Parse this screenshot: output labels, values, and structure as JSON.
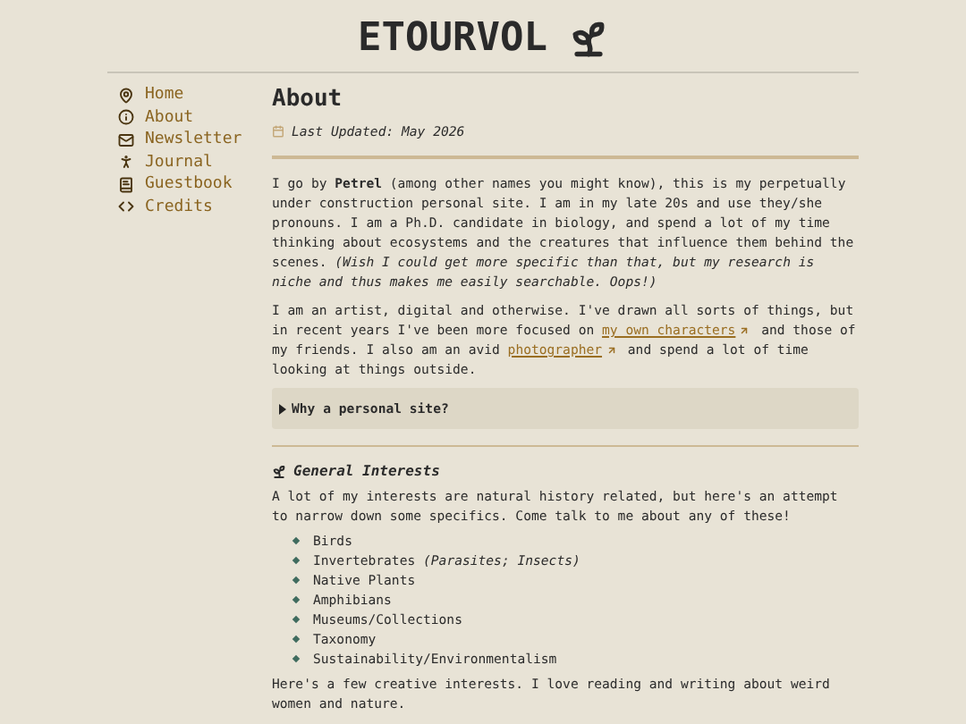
{
  "site_title": "ETOURVOL",
  "nav": [
    {
      "kind": "pin",
      "label": "Home"
    },
    {
      "kind": "info",
      "label": "About"
    },
    {
      "kind": "mail",
      "label": "Newsletter"
    },
    {
      "kind": "hiker",
      "label": "Journal"
    },
    {
      "kind": "book",
      "label": "Guestbook"
    },
    {
      "kind": "code",
      "label": "Credits"
    }
  ],
  "page": {
    "heading": "About",
    "last_updated": "Last Updated: May 2026",
    "paragraphs": [
      [
        {
          "kind": "text",
          "text": "I go by **Petrel** (among other names you might know), this is my perpetually under construction personal site. I am in my late 20s and use they/she pronouns. I am a Ph.D. candidate in biology, and spend a lot of my time thinking about ecosystems and the creatures that influence them behind the scenes. *(Wish I could get more specific than that, but my research is niche and thus makes me easily searchable. Oops!)*"
        }
      ],
      [
        {
          "kind": "text",
          "text": "I am an artist, digital and otherwise. I've drawn all sorts of things, but in recent years I've been more focused on "
        },
        {
          "kind": "link",
          "text": "my own characters"
        },
        {
          "kind": "text",
          "text": " and those of my friends. I also am an avid "
        },
        {
          "kind": "link",
          "text": "photographer"
        },
        {
          "kind": "text",
          "text": " and spend a lot of time looking at things outside."
        }
      ]
    ],
    "details": {
      "summary": "Why a personal site?",
      "expanded": false
    },
    "section": {
      "heading": "General Interests",
      "intro": "A lot of my interests are natural history related, but here's an attempt to narrow down some specifics. Come talk to me about any of these!",
      "items": [
        "Birds",
        "Invertebrates *(Parasites; Insects)*",
        "Native Plants",
        "Amphibians",
        "Museums/Collections",
        "Taxonomy",
        "Sustainability/Environmentalism"
      ],
      "outro": "Here's a few creative interests. I love reading and writing about weird women and nature."
    }
  }
}
